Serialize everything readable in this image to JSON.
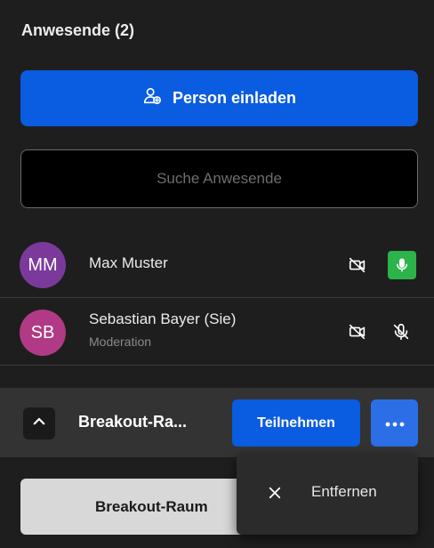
{
  "panel": {
    "title": "Anwesende (2)"
  },
  "invite": {
    "label": "Person einladen",
    "icon": "user-plus-icon"
  },
  "search": {
    "placeholder": "Suche Anwesende",
    "value": ""
  },
  "participants": [
    {
      "initials": "MM",
      "name": "Max Muster",
      "role": "",
      "avatar_color": "#7b3a9b",
      "camera": "off",
      "mic": "on"
    },
    {
      "initials": "SB",
      "name": "Sebastian Bayer (Sie)",
      "role": "Moderation",
      "avatar_color": "#b03a86",
      "camera": "off",
      "mic": "off"
    }
  ],
  "breakout": {
    "name": "Breakout-Ra...",
    "join_label": "Teilnehmen",
    "room_button_label": "Breakout-Raum"
  },
  "menu": {
    "items": [
      {
        "label": "Entfernen",
        "icon": "close-icon"
      }
    ]
  },
  "colors": {
    "accent": "#0a5ce0",
    "mic_on": "#2cb34a",
    "background": "#1e1e1e"
  }
}
